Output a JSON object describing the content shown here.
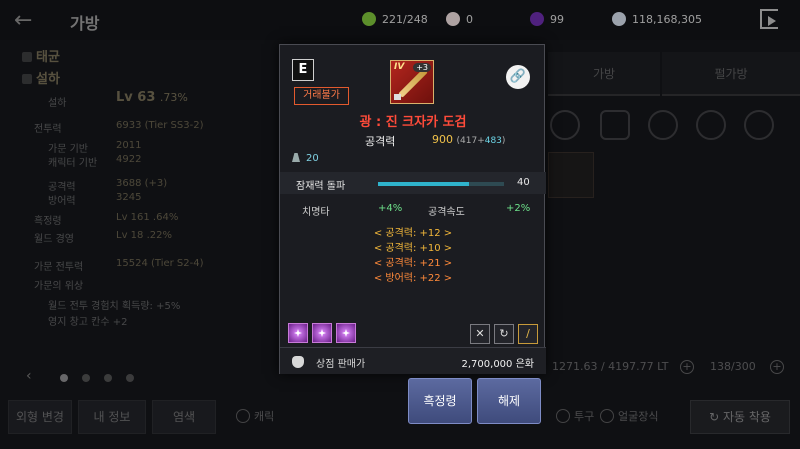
{
  "header": {
    "title": "가방",
    "currencies": [
      {
        "icon": "energy-icon",
        "value": "221/248",
        "color": "#7bbf3a"
      },
      {
        "icon": "pearl-icon",
        "value": "0",
        "color": "#e8d8d8"
      },
      {
        "icon": "dark-crystal-icon",
        "value": "99",
        "color": "#6a2ca8"
      },
      {
        "icon": "silver-coin-icon",
        "value": "118,168,305",
        "color": "#cfd8e6"
      }
    ]
  },
  "character": {
    "family": "태균",
    "name": "설하",
    "class": "설하",
    "level": "Lv 63",
    "level_pct": ".73%",
    "stats": [
      {
        "label": "전투력",
        "value": "6933 (Tier SS3-2)"
      },
      {
        "label": "가문 기반",
        "value": "2011"
      },
      {
        "label": "캐릭터 기반",
        "value": "4922"
      },
      {
        "label": "공격력",
        "value": "3688 (+3)"
      },
      {
        "label": "방어력",
        "value": "3245"
      },
      {
        "label": "흑정령",
        "value": "Lv 161 .64%"
      },
      {
        "label": "월드 경영",
        "value": "Lv 18 .22%"
      },
      {
        "label": "가문 전투력",
        "value": "15524 (Tier S2-4)"
      },
      {
        "label": "가문의 위상",
        "value": ""
      }
    ],
    "notes": [
      "월드 전투 경험치 획득량: +5%",
      "영지 창고 칸수 +2"
    ]
  },
  "bottom_left": {
    "buttons": [
      "외형 변경",
      "내 정보",
      "염색"
    ],
    "check_label": "캐릭"
  },
  "right_panel": {
    "tabs": [
      "가방",
      "펄가방"
    ],
    "capacity": "1271.63 / 4197.77 LT",
    "slots": "138/300",
    "checks": [
      "투구",
      "얼굴장식"
    ],
    "auto_button": "자동 착용"
  },
  "item": {
    "grade": "E",
    "enhance": "IV",
    "plus": "+3",
    "trade_tag": "거래불가",
    "name": "광 : 진 크자카 도검",
    "attack_label": "공격력",
    "attack_value": "900",
    "attack_base": "(417+",
    "attack_bonus": "483",
    "attack_close": ")",
    "weight": "20",
    "potential_label": "잠재력 돌파",
    "potential_value": "40",
    "potential_fill": 0.72,
    "crit_label": "치명타",
    "crit_value": "+4%",
    "atkspd_label": "공격속도",
    "atkspd_value": "+2%",
    "options": [
      {
        "text": "< 공격력: +12 >",
        "tone": "optY"
      },
      {
        "text": "< 공격력: +10 >",
        "tone": "optY"
      },
      {
        "text": "< 공격력: +21 >",
        "tone": "optO"
      },
      {
        "text": "< 방어력: +22 >",
        "tone": "optO"
      }
    ],
    "sell_label": "상점 판매가",
    "sell_value": "2,700,000 은화"
  },
  "actions": {
    "spirit": "흑정령",
    "unequip": "해제"
  }
}
